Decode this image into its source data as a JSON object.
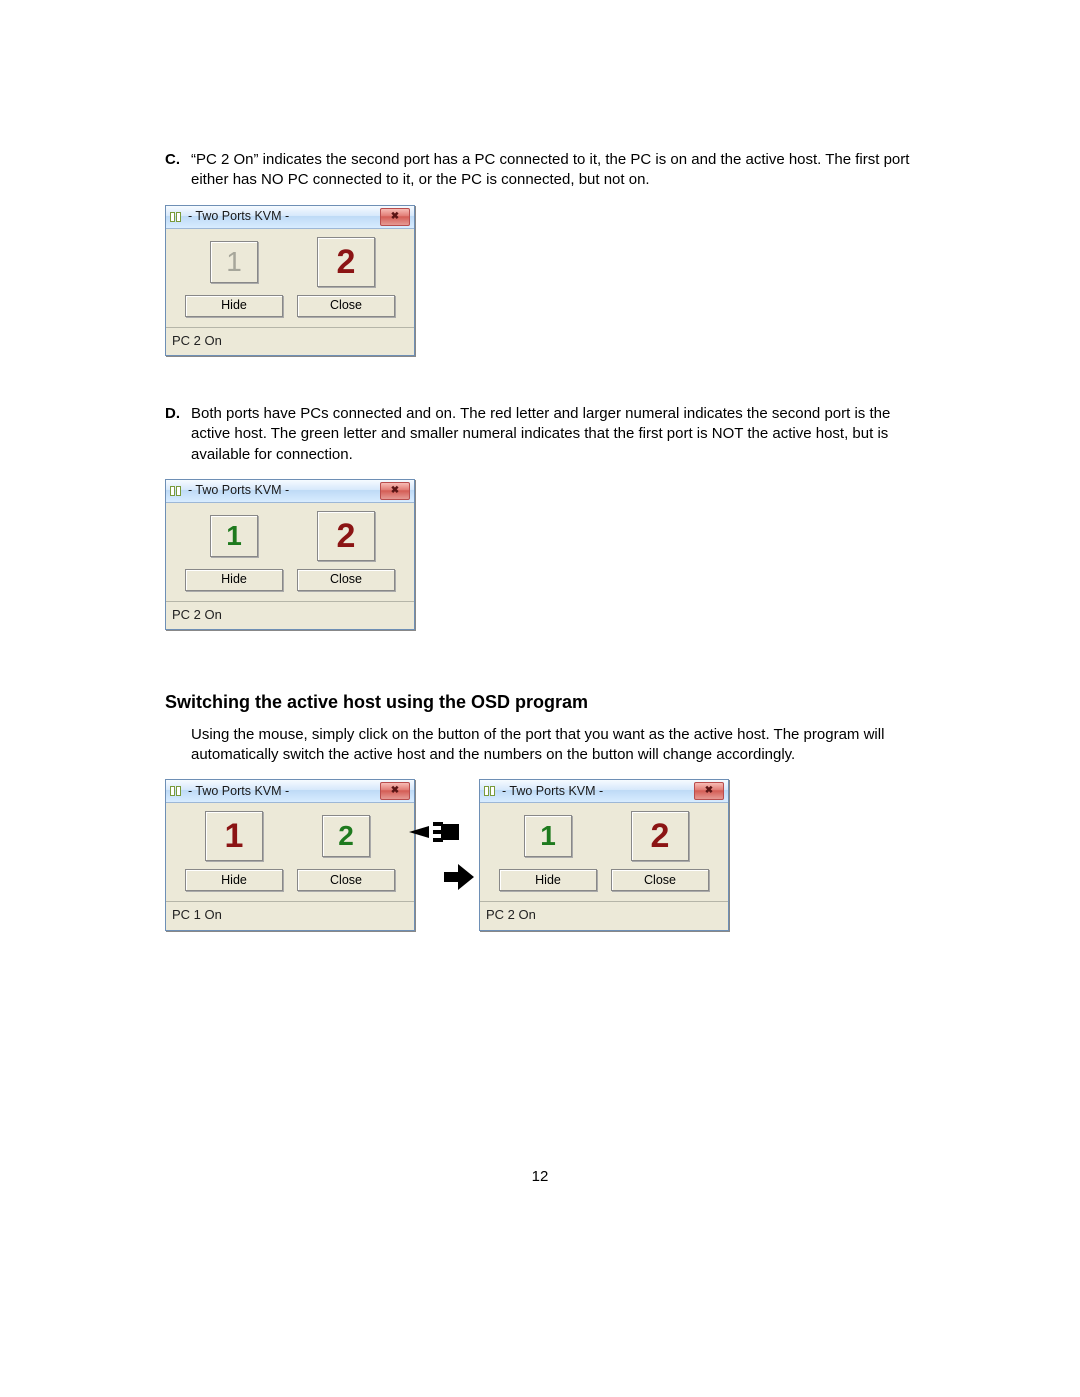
{
  "items": {
    "c": {
      "marker": "C.",
      "text": "“PC 2 On” indicates the second port has a PC connected to it, the PC is on and the active host. The first port either has NO PC connected to it, or the PC is connected, but not on."
    },
    "d": {
      "marker": "D.",
      "text": "Both ports have PCs connected and on. The red letter and larger numeral indicates the second port is the active host. The green letter and smaller numeral indicates that the first port is NOT the active host, but is available for connection."
    }
  },
  "heading": "Switching the active host using the OSD program",
  "paragraph": "Using the mouse, simply click on the button of the port that you want as the active host. The program will automatically switch the active host and the numbers on the button will change accordingly.",
  "page_number": "12",
  "kvm": {
    "title": "- Two Ports KVM -",
    "close_x": "✖",
    "hide": "Hide",
    "close": "Close",
    "port1": "1",
    "port2": "2",
    "status_pc1on": "PC 1 On",
    "status_pc2on": "PC 2 On"
  }
}
